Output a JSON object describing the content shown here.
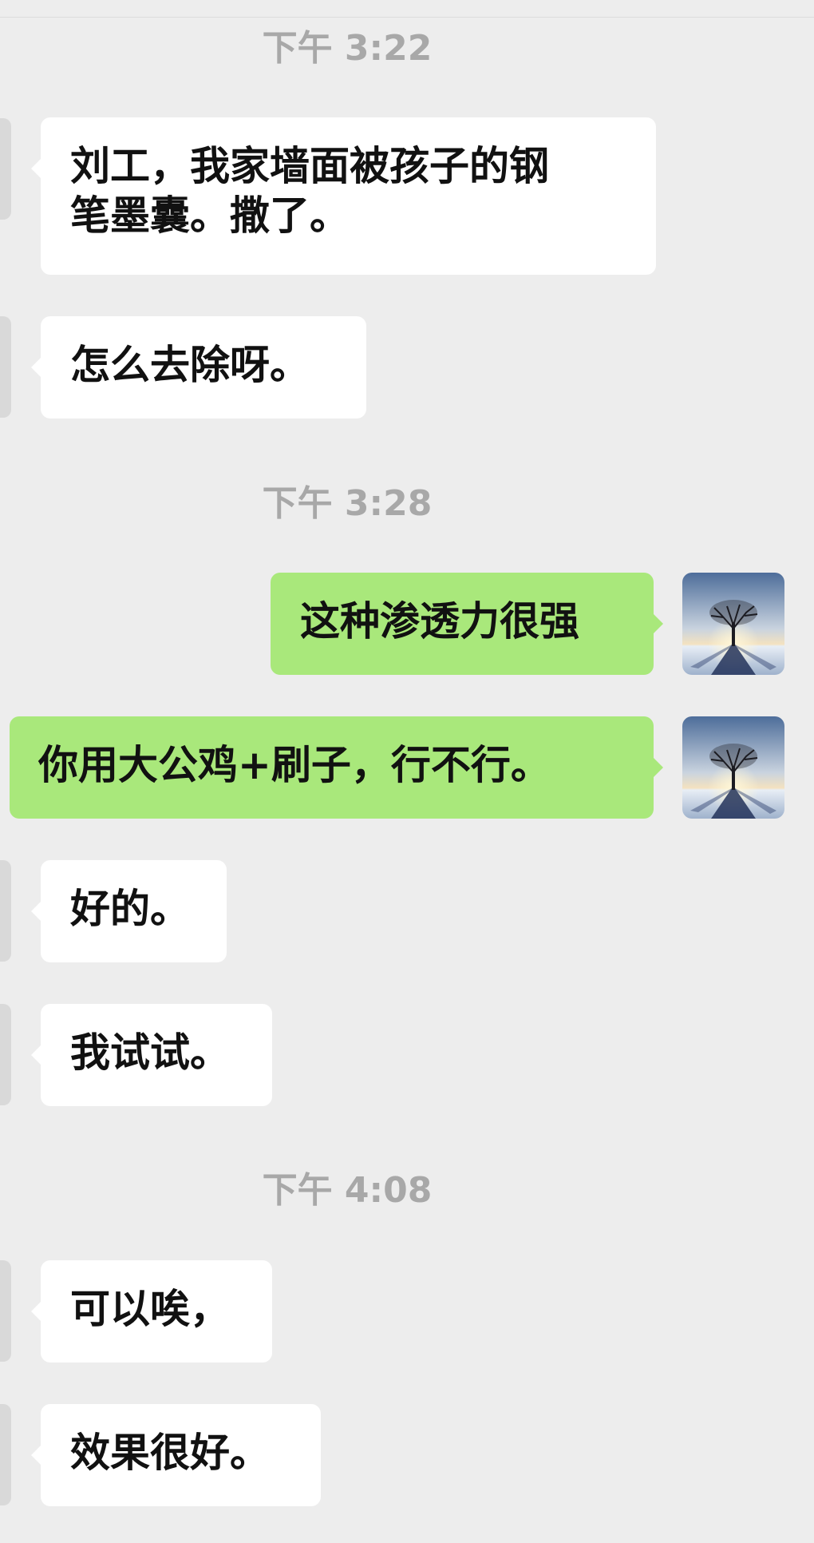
{
  "messages": {
    "t1": "下午 3:22",
    "m1": "刘工，我家墙面被孩子的钢\n笔墨囊。撒了。",
    "m2": "怎么去除呀。",
    "t2": "下午 3:28",
    "m3": "这种渗透力很强",
    "m4": "你用大公鸡+刷子，行不行。",
    "m5": "好的。",
    "m6": "我试试。",
    "t3": "下午 4:08",
    "m7": "可以唉，",
    "m8": "效果很好。"
  },
  "icons": {
    "self_avatar": "tree-sunset-avatar-icon"
  },
  "colors": {
    "background": "#ededed",
    "incoming_bubble": "#ffffff",
    "outgoing_bubble": "#a9e87b",
    "timestamp": "#a8a8a8"
  }
}
